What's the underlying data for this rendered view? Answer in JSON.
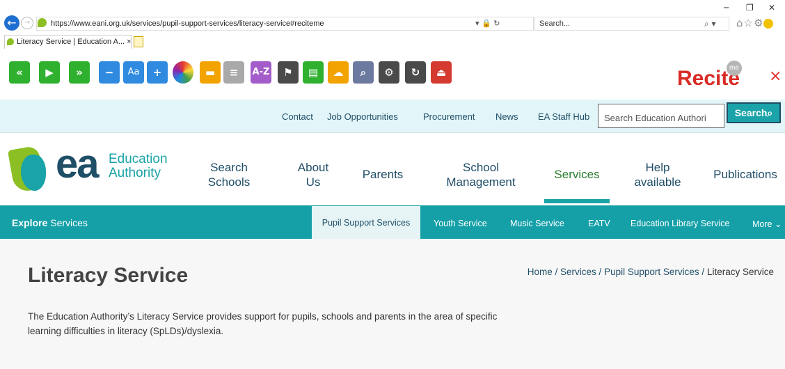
{
  "browser": {
    "url": "https://www.eani.org.uk/services/pupil-support-services/literacy-service#reciteme",
    "search_placeholder": "Search...",
    "tab_title": "Literacy Service | Education A...",
    "tab_close": "×"
  },
  "recite": {
    "logo_text": "Recite",
    "logo_badge": "me",
    "close": "×",
    "buttons": [
      "rewind-icon",
      "play-icon",
      "fast-forward-icon",
      "decrease-text-icon",
      "font-icon",
      "increase-text-icon",
      "color-wheel-icon",
      "ruler-icon",
      "screen-mask-icon",
      "dictionary-icon",
      "translate-icon",
      "text-only-icon",
      "download-audio-icon",
      "magnifier-icon",
      "settings-icon",
      "reset-icon",
      "exit-icon"
    ]
  },
  "utility": {
    "links": [
      "Contact",
      "Job Opportunities",
      "Procurement",
      "News",
      "EA Staff Hub"
    ],
    "search_placeholder": "Search Education Authori",
    "search_button": "Search"
  },
  "header": {
    "logo_letters": "ea",
    "logo_line1": "Education",
    "logo_line2": "Authority",
    "nav": [
      {
        "line1": "Search",
        "line2": "Schools"
      },
      {
        "line1": "About",
        "line2": "Us"
      },
      {
        "line1": "Parents",
        "line2": ""
      },
      {
        "line1": "School",
        "line2": "Management"
      },
      {
        "line1": "Services",
        "line2": ""
      },
      {
        "line1": "Help",
        "line2": "available"
      },
      {
        "line1": "Publications",
        "line2": ""
      }
    ]
  },
  "services_nav": {
    "explore_bold": "Explore",
    "explore_rest": "Services",
    "links": [
      "Pupil Support Services",
      "Youth Service",
      "Music Service",
      "EATV",
      "Education Library Service",
      "More"
    ]
  },
  "content": {
    "title": "Literacy Service",
    "breadcrumb": [
      "Home",
      "Services",
      "Pupil Support Services",
      "Literacy Service"
    ],
    "separator": "/",
    "body": "The Education Authority’s Literacy Service provides support for pupils, schools and parents in the area of specific learning difficulties in literacy (SpLDs)/dyslexia."
  }
}
